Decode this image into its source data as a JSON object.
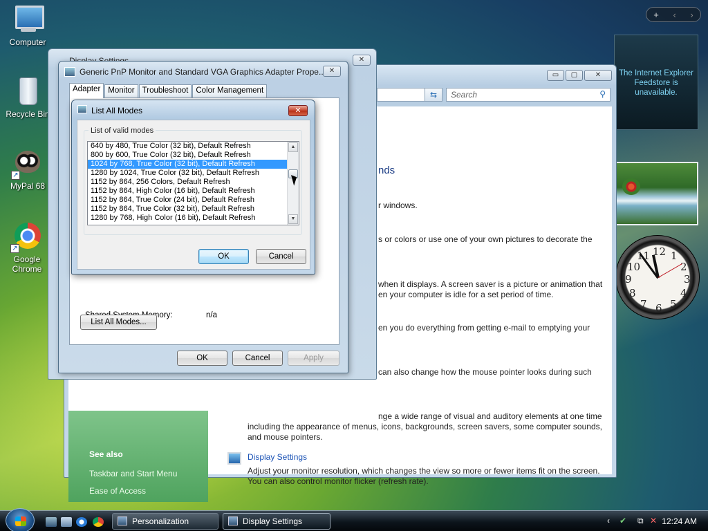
{
  "desktop": {
    "icons": [
      {
        "label": "Computer"
      },
      {
        "label": "Recycle Bin"
      },
      {
        "label": "MyPal 68"
      },
      {
        "label": "Google Chrome"
      }
    ]
  },
  "sidebar": {
    "controls": [
      "+",
      "‹",
      "›"
    ],
    "feed_message": "The Internet Explorer Feedstore is unavailable.",
    "clock": {
      "numbers": [
        "12",
        "1",
        "2",
        "3",
        "4",
        "5",
        "6",
        "7",
        "8",
        "9",
        "10",
        "11"
      ],
      "time": "12:24"
    }
  },
  "personalization": {
    "search_placeholder": "Search",
    "heading_fragment": "nds",
    "texts": [
      "r windows.",
      "s or colors or use one of your own pictures to decorate the",
      "when it displays. A screen saver is a picture or animation that",
      "en your computer is idle for a set period of time.",
      "en you do everything from getting e-mail to emptying your",
      "can also change how the mouse pointer looks during such",
      "nge a wide range of visual and auditory elements at one time",
      "including the appearance of menus, icons, backgrounds, screen savers, some computer sounds,",
      "and mouse pointers."
    ],
    "display_settings_link": "Display Settings",
    "display_settings_desc": [
      "Adjust your monitor resolution, which changes the view so more or fewer items fit on the screen.",
      "You can also control monitor flicker (refresh rate)."
    ],
    "see_also": {
      "title": "See also",
      "links": [
        "Taskbar and Start Menu",
        "Ease of Access"
      ]
    }
  },
  "display_settings_window": {
    "title": "Display Settings"
  },
  "properties_dialog": {
    "title": "Generic PnP Monitor and Standard VGA Graphics Adapter Prope...",
    "tabs": [
      "Adapter",
      "Monitor",
      "Troubleshoot",
      "Color Management"
    ],
    "shared_memory_label": "Shared System Memory:",
    "shared_memory_value": "n/a",
    "list_all_modes_btn": "List All Modes...",
    "ok": "OK",
    "cancel": "Cancel",
    "apply": "Apply"
  },
  "list_modes_dialog": {
    "title": "List All Modes",
    "group_label": "List of valid modes",
    "modes": [
      "640 by 480, True Color (32 bit), Default Refresh",
      "800 by 600, True Color (32 bit), Default Refresh",
      "1024 by 768, True Color (32 bit), Default Refresh",
      "1280 by 1024, True Color (32 bit), Default Refresh",
      "1152 by 864, 256 Colors, Default Refresh",
      "1152 by 864, High Color (16 bit), Default Refresh",
      "1152 by 864, True Color (24 bit), Default Refresh",
      "1152 by 864, True Color (32 bit), Default Refresh",
      "1280 by 768, High Color (16 bit), Default Refresh"
    ],
    "selected_index": 2,
    "ok": "OK",
    "cancel": "Cancel"
  },
  "taskbar": {
    "buttons": [
      {
        "label": "Personalization"
      },
      {
        "label": "Display Settings"
      }
    ],
    "active_index": 1,
    "time": "12:24 AM"
  }
}
